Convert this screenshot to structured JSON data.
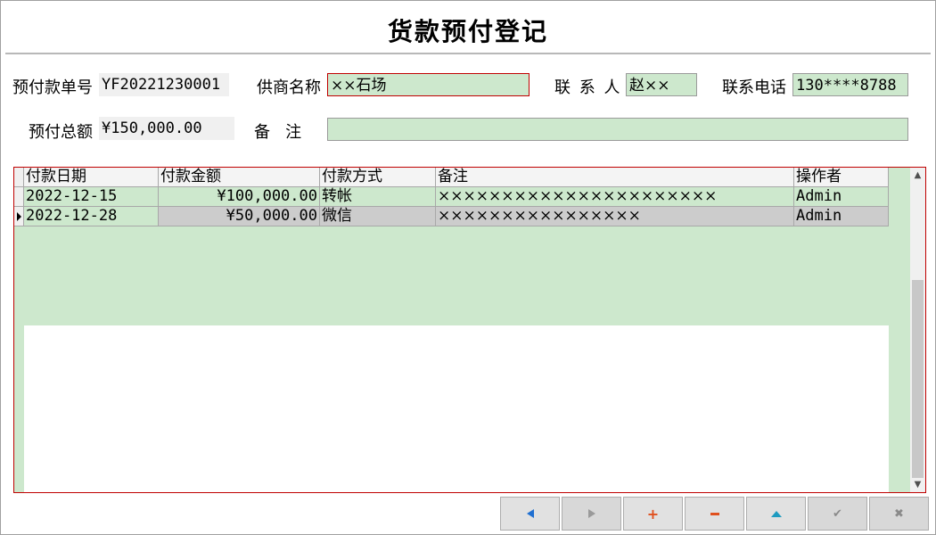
{
  "window": {
    "title": "货款预付登记"
  },
  "form": {
    "order_no": {
      "label": "预付款单号",
      "value": "YF20221230001"
    },
    "supplier": {
      "label": "供商名称",
      "value": "××石场"
    },
    "contact": {
      "label": "联 系 人",
      "value": "赵××"
    },
    "phone": {
      "label": "联系电话",
      "value": "130****8788"
    },
    "total": {
      "label": "预付总额",
      "value": "¥150,000.00"
    },
    "remark": {
      "label": "备   注",
      "value": ""
    }
  },
  "grid": {
    "columns": [
      "付款日期",
      "付款金额",
      "付款方式",
      "备注",
      "操作者"
    ],
    "rows": [
      {
        "date": "2022-12-15",
        "amount": "¥100,000.00",
        "method": "转帐",
        "note": "××××××××××××××××××××××",
        "operator": "Admin"
      },
      {
        "date": "2022-12-28",
        "amount": "¥50,000.00",
        "method": "微信",
        "note": "××××××××××××××××",
        "operator": "Admin"
      }
    ],
    "current_row": 2
  },
  "scrollbar": {
    "up_icon": "up-arrow-icon",
    "down_icon": "down-arrow-icon"
  },
  "toolbar": {
    "buttons": [
      {
        "name": "prev-record",
        "icon": "triangle-left-icon",
        "color": "#1f6fd1",
        "enabled": true
      },
      {
        "name": "next-record",
        "icon": "triangle-right-icon",
        "color": "#9a9a9a",
        "enabled": false
      },
      {
        "name": "add",
        "icon": "plus-icon",
        "color": "#e0501e",
        "enabled": true
      },
      {
        "name": "delete",
        "icon": "minus-icon",
        "color": "#e0501e",
        "enabled": true
      },
      {
        "name": "first",
        "icon": "triangle-up-icon",
        "color": "#1e9bc0",
        "enabled": true
      },
      {
        "name": "save",
        "icon": "check-icon",
        "color": "#8a8a8a",
        "enabled": false
      },
      {
        "name": "cancel",
        "icon": "x-icon",
        "color": "#8a8a8a",
        "enabled": false
      }
    ]
  },
  "colors": {
    "editable_bg": "#cde8cd",
    "highlight_border": "#c00000",
    "readonly_bg": "#f0f0f0"
  }
}
